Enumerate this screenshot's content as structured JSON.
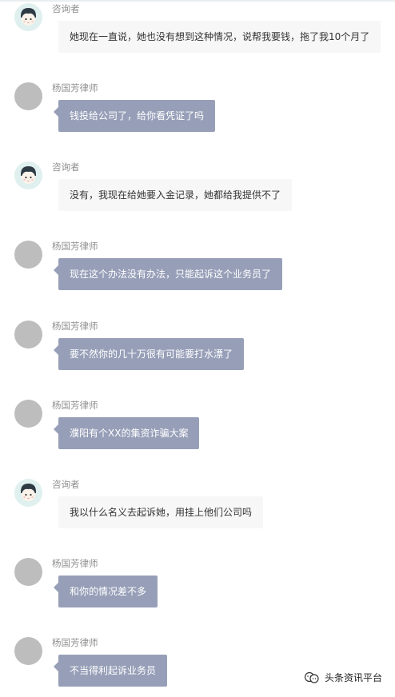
{
  "colors": {
    "lawyer_bubble": "#979fb8",
    "client_bubble": "#f7f7f7",
    "lawyer_avatar": "#bdbdbd",
    "client_avatar": "#dff0ef"
  },
  "messages": [
    {
      "sender": "咨询者",
      "role": "client",
      "text": "她现在一直说，她也没有想到这种情况，说帮我要钱，拖了我10个月了"
    },
    {
      "sender": "杨国芳律师",
      "role": "lawyer",
      "text": "钱投给公司了，给你看凭证了吗"
    },
    {
      "sender": "咨询者",
      "role": "client",
      "text": "没有，我现在给她要入金记录，她都给我提供不了"
    },
    {
      "sender": "杨国芳律师",
      "role": "lawyer",
      "text": "现在这个办法没有办法，只能起诉这个业务员了"
    },
    {
      "sender": "杨国芳律师",
      "role": "lawyer",
      "text": "要不然你的几十万很有可能要打水漂了"
    },
    {
      "sender": "杨国芳律师",
      "role": "lawyer",
      "text": "濮阳有个XX的集资诈骗大案"
    },
    {
      "sender": "咨询者",
      "role": "client",
      "text": "我以什么名义去起诉她，用挂上他们公司吗"
    },
    {
      "sender": "杨国芳律师",
      "role": "lawyer",
      "text": "和你的情况差不多"
    },
    {
      "sender": "杨国芳律师",
      "role": "lawyer",
      "text": "不当得利起诉业务员"
    }
  ],
  "watermark": {
    "icon": "wechat-official-account-icon",
    "text": "头条资讯平台"
  }
}
